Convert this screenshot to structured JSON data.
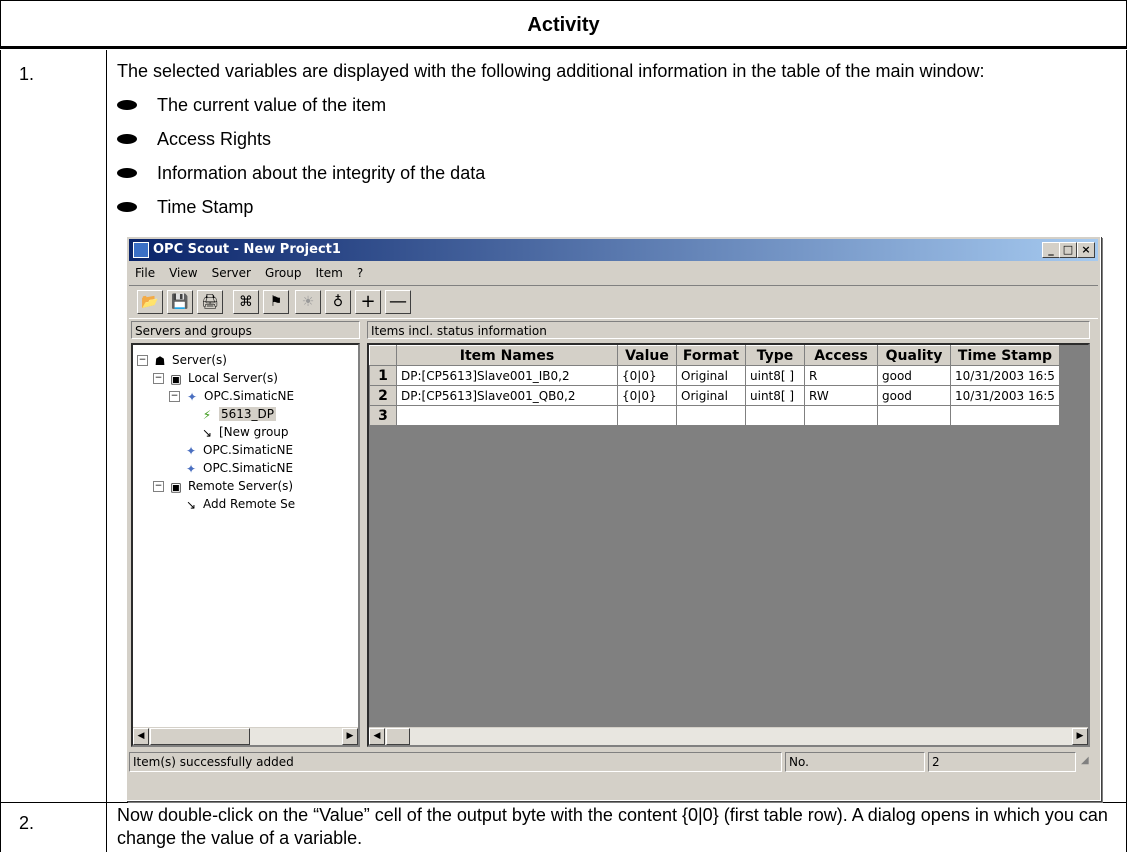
{
  "header": {
    "title": "Activity"
  },
  "row1": {
    "num": "1.",
    "intro": "The selected variables are displayed with the following additional information in the table of the main window:",
    "bullets": [
      "The current value of the item",
      "Access Rights",
      "Information about the integrity of the data",
      "Time Stamp"
    ]
  },
  "window": {
    "title": "OPC Scout - New Project1",
    "controls": [
      "_",
      "□",
      "×"
    ],
    "menu": [
      "File",
      "View",
      "Server",
      "Group",
      "Item",
      "?"
    ],
    "left_pane_label": "Servers and groups",
    "right_pane_label": "Items incl. status information",
    "tree": [
      "Server(s)",
      "Local Server(s)",
      "OPC.SimaticNE",
      "5613_DP",
      "[New group",
      "OPC.SimaticNE",
      "OPC.SimaticNE",
      "Remote Server(s)",
      "Add Remote Se"
    ],
    "columns": [
      "Item Names",
      "Value",
      "Format",
      "Type",
      "Access",
      "Quality",
      "Time Stamp"
    ],
    "rows": [
      {
        "n": "1",
        "cells": [
          "DP:[CP5613]Slave001_IB0,2",
          "{0|0}",
          "Original",
          "uint8[ ]",
          "R",
          "good",
          "10/31/2003 16:5"
        ]
      },
      {
        "n": "2",
        "cells": [
          "DP:[CP5613]Slave001_QB0,2",
          "{0|0}",
          "Original",
          "uint8[ ]",
          "RW",
          "good",
          "10/31/2003 16:5"
        ]
      },
      {
        "n": "3",
        "cells": [
          "",
          "",
          "",
          "",
          "",
          "",
          ""
        ]
      }
    ],
    "status": {
      "message": "Item(s) successfully added",
      "no_label": "No.",
      "no_value": "2"
    }
  },
  "row2": {
    "num": "2.",
    "text": "Now double-click on the “Value” cell of the output byte with the content {0|0} (first table row). A dialog opens in which you can change the value of a variable."
  }
}
